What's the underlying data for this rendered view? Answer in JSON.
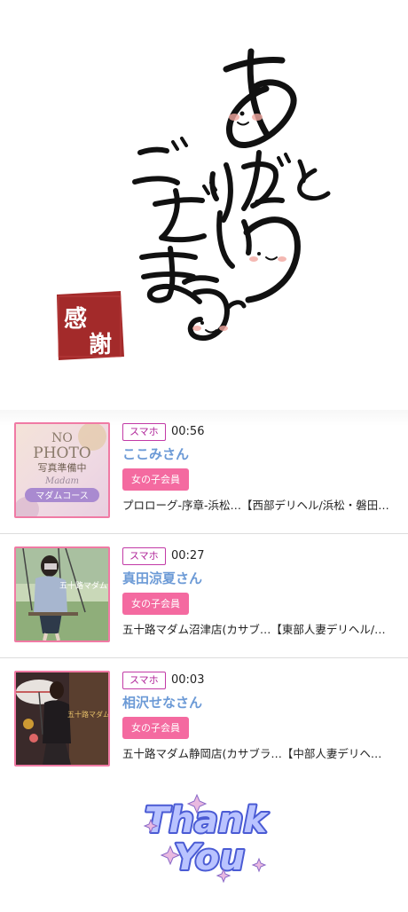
{
  "hero": {
    "title_line1": "ありがとう",
    "title_line2": "ございます",
    "seal_char1": "感",
    "seal_char2": "謝"
  },
  "visits": [
    {
      "device": "スマホ",
      "time": "00:56",
      "name": "ここみさん",
      "member_label": "女の子会員",
      "shop": "プロローグ-序章-浜松…【西部デリヘル/浜松・磐田…",
      "thumb": {
        "line1": "NO",
        "line2": "PHOTO",
        "line3": "写真準備中",
        "line4": "マダムコース",
        "script": "Madam"
      }
    },
    {
      "device": "スマホ",
      "time": "00:27",
      "name": "真田涼夏さん",
      "member_label": "女の子会員",
      "shop": "五十路マダム沼津店(カサブ…【東部人妻デリヘル/…",
      "thumb": {
        "overlay": "五十路マダム"
      }
    },
    {
      "device": "スマホ",
      "time": "00:03",
      "name": "相沢せなさん",
      "member_label": "女の子会員",
      "shop": "五十路マダム静岡店(カサブラ…【中部人妻デリヘ…",
      "thumb": {
        "overlay": "五十路マダム"
      }
    }
  ],
  "footer": {
    "thanks_line1": "Thank",
    "thanks_line2": "You"
  }
}
